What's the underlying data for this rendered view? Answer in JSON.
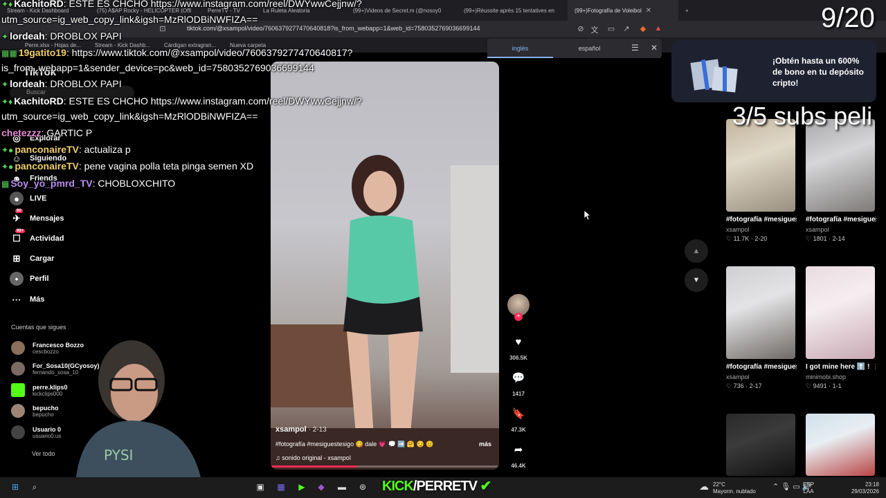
{
  "browser": {
    "tabs": [
      {
        "label": "Stream - Kick Dashboard",
        "active": false
      },
      {
        "label": "(75) A$AP Rocky - HELICOPTER (Offi",
        "active": false
      },
      {
        "label": "PerreTV - TV",
        "active": false
      },
      {
        "label": "La Ruleta Aleatoria",
        "active": false
      },
      {
        "label": "(99+)Videos de Secret.m (@nosoy0",
        "active": false
      },
      {
        "label": "(99+)Réussite après 15 tentatives en",
        "active": false
      },
      {
        "label": "(99+)Fotografía de Voleibol",
        "active": true
      }
    ],
    "url": "tiktok.com/@xsampol/video/7606379277470640818?is_from_webapp=1&web_id=7580352769036699144",
    "bookmarks": [
      "Perre.xlsx - Hojas de...",
      "Stream - Kick Dashb...",
      "Cárdigan extragran...",
      "Nueva carpeta"
    ]
  },
  "translate": {
    "lang_from": "inglés",
    "lang_to": "español"
  },
  "overlay": {
    "counter": "9/20",
    "subs": "3/5 subs peli",
    "chat": [
      {
        "user": "KachitoRD",
        "text": ": ESTE ES CHCHO https://www.instagram.com/reel/DWYwwCejjnw/?",
        "color": "#f4f4f4"
      },
      {
        "user": "",
        "text": "utm_source=ig_web_copy_link&igsh=MzRlODBiNWFIZA==",
        "color": "#f4f4f4"
      },
      {
        "user": "lordeah",
        "text": ": DROBLOX PAPI",
        "color": "#f4f4f4"
      },
      {
        "user": "19gatito19",
        "text": ": https://www.tiktok.com/@xsampol/video/7606379277470640817?",
        "color": "#f4f4f4"
      },
      {
        "user": "",
        "text": "is_from_webapp=1&sender_device=pc&web_id=7580352769036699144",
        "color": "#f4f4f4"
      },
      {
        "user": "lordeah",
        "text": ": DROBLOX PAPI",
        "color": "#f4f4f4"
      },
      {
        "user": "KachitoRD",
        "text": ": ESTE ES CHCHO https://www.instagram.com/reel/DWYwwCejjnw/?",
        "color": "#f4f4f4"
      },
      {
        "user": "",
        "text": "utm_source=ig_web_copy_link&igsh=MzRlODBiNWFIZA==",
        "color": "#f4f4f4"
      },
      {
        "user": "chetezzz",
        "text": ": GARTIC P",
        "color": "#f4f4f4"
      },
      {
        "user": "panconaireTV",
        "text": ": actualiza p",
        "color": "#f4f4f4"
      },
      {
        "user": "panconaireTV",
        "text": ": pene vagina polla teta pinga semen XD",
        "color": "#f4f4f4"
      },
      {
        "user": "Soy_yo_pmrd_TV",
        "text": ": CHOBLOXCHITO",
        "color": "#f4f4f4"
      }
    ]
  },
  "sidebar": {
    "logo": "TikTok",
    "search_placeholder": "Buscar",
    "nav": [
      {
        "label": "Explorar",
        "icon": "compass-icon"
      },
      {
        "label": "Siguiendo",
        "icon": "following-icon"
      },
      {
        "label": "Friends",
        "icon": "friends-icon"
      },
      {
        "label": "LIVE",
        "icon": "live-icon"
      },
      {
        "label": "Mensajes",
        "icon": "messages-icon",
        "badge": "90"
      },
      {
        "label": "Actividad",
        "icon": "activity-icon",
        "badge": "99+"
      },
      {
        "label": "Cargar",
        "icon": "upload-icon"
      },
      {
        "label": "Perfil",
        "icon": "profile-icon"
      },
      {
        "label": "Más",
        "icon": "more-icon"
      }
    ],
    "following_title": "Cuentas que sigues",
    "following": [
      {
        "name": "Francesco Bozzo",
        "handle": "cescbozzo"
      },
      {
        "name": "For_Sosa10(GCyosoy)",
        "handle": "fernando_sosa_10"
      },
      {
        "name": "perre.klips0",
        "handle": "kickclips000"
      },
      {
        "name": "bepucho",
        "handle": "bepucho"
      },
      {
        "name": "Usuario 0",
        "handle": "usuario0.us"
      }
    ],
    "see_all": "Ver todo"
  },
  "video": {
    "author": "xsampol",
    "date": "· 2-13",
    "caption": "#fotografía #mesiguestesigo 😋 dale 💗 💭 ➡️ 🤗 😏 😊",
    "more": "más",
    "sound": "sonido original - xsampol",
    "progress": 0.38,
    "likes": "306.5K",
    "comments": "1417",
    "saves": "47.3K",
    "shares": "46.4K"
  },
  "ad": {
    "text": "¡Obtén hasta un 600% de bono en tu depósito cripto!"
  },
  "grid": [
    {
      "title": "#fotografía #mesiguestesigo...",
      "author": "xsampol",
      "stats": "♡ 11.7K · 2-20",
      "thumb": "linear-gradient(160deg,#c2b49c,#e0d8c8 40%,#9a8f80)"
    },
    {
      "title": "#fotografía #mesiguestesigo...",
      "author": "xsampol",
      "stats": "♡ 1801 · 2-14",
      "thumb": "linear-gradient(160deg,#a8a8aa,#d6d6d8 40%,#7d7a78)"
    },
    {
      "title": "#fotografía #mesiguestesigo...",
      "author": "xsampol",
      "stats": "♡ 736 · 2-17",
      "thumb": "linear-gradient(160deg,#cfcfd2,#e3e3e5 40%,#6e6a66)"
    },
    {
      "title": "I got mine here ⬆️ !",
      "author": "minimobi.shop",
      "stats": "♡ 9491 · 1-1",
      "thumb": "linear-gradient(160deg,#eadbe0,#f5eef0 40%,#c8a9b3)"
    },
    {
      "title": "",
      "author": "",
      "stats": "",
      "thumb": "linear-gradient(160deg,#2a2a2a,#3b3b3b 40%,#111)"
    },
    {
      "title": "",
      "author": "",
      "stats": "",
      "thumb": "linear-gradient(160deg,#cfe0ec,#e8eef2 40%,#b84545)"
    }
  ],
  "taskbar": {
    "stream_brand_a": "KICK",
    "stream_brand_b": "/PERRETV",
    "weather_temp": "22°C",
    "weather_desc": "Mayorm. nublado",
    "lang": "ESP",
    "lang_sub": "LAA",
    "time": "23:18",
    "date": "29/03/2026"
  }
}
